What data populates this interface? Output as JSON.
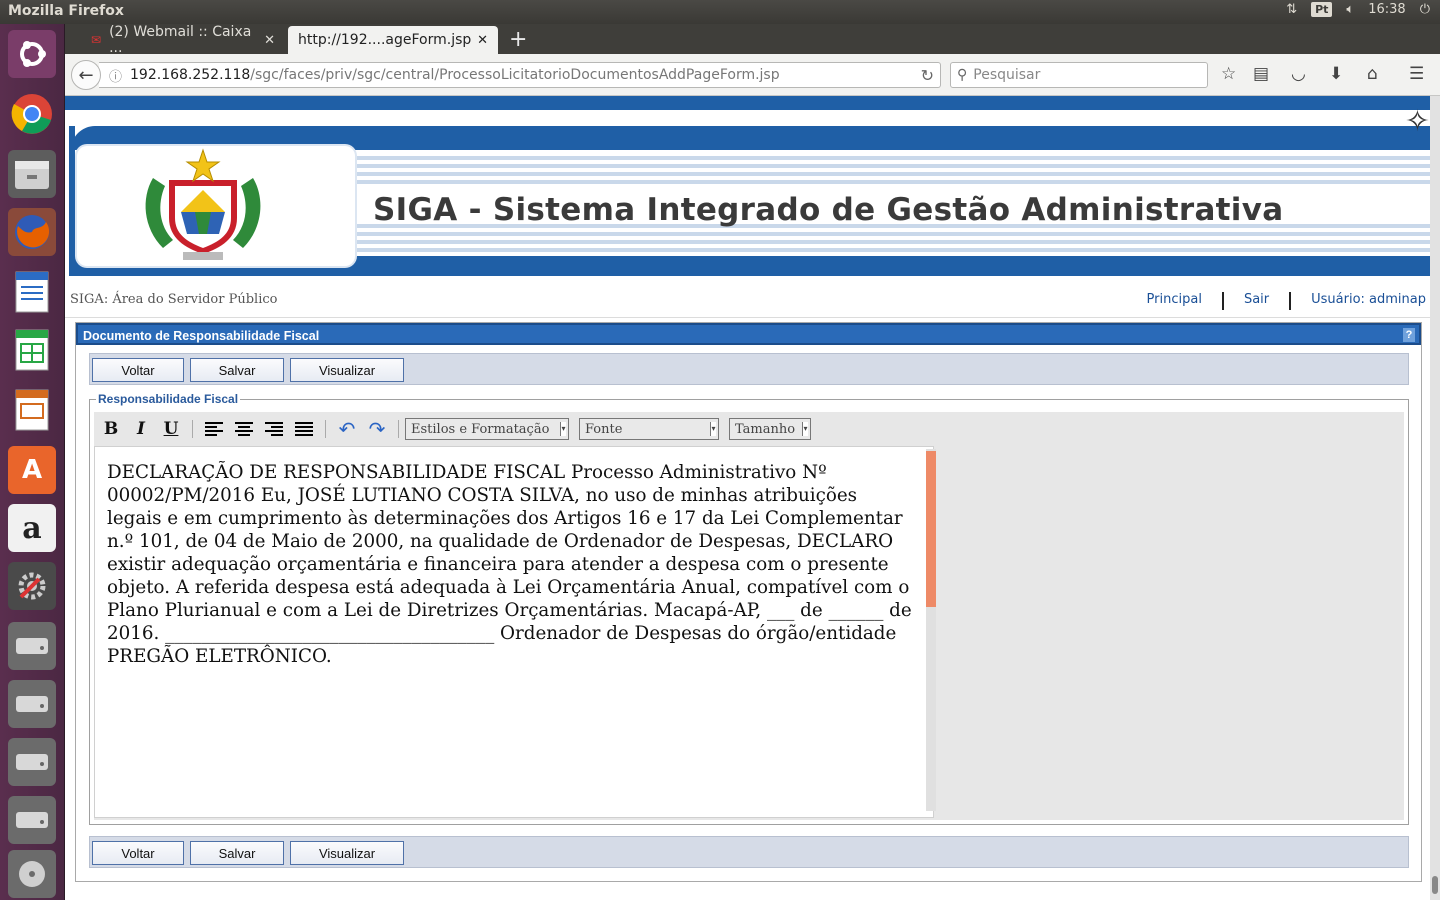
{
  "os": {
    "app_title": "Mozilla Firefox",
    "keyboard_layout": "Pt",
    "clock": "16:38"
  },
  "browser": {
    "tabs": [
      {
        "label": "(2) Webmail :: Caixa ...",
        "active": false
      },
      {
        "label": "http://192....ageForm.jsp",
        "active": true
      }
    ],
    "url_host": "192.168.252.118",
    "url_path": "/sgc/faces/priv/sgc/central/ProcessoLicitatorioDocumentosAddPageForm.jsp",
    "search_placeholder": "Pesquisar"
  },
  "site": {
    "banner_title": "SIGA - Sistema Integrado de Gestão Administrativa",
    "area_label": "SIGA: Área do Servidor Público",
    "nav": {
      "home": "Principal",
      "logout": "Sair",
      "user": "Usuário: adminap"
    }
  },
  "panel": {
    "title": "Documento de Responsabilidade Fiscal",
    "help": "?",
    "buttons": {
      "back": "Voltar",
      "save": "Salvar",
      "preview": "Visualizar"
    },
    "fieldset_legend": "Responsabilidade Fiscal",
    "toolbar": {
      "bold": "B",
      "italic": "I",
      "underline": "U",
      "styles_select": "Estilos e Formatação",
      "font_select": "Fonte",
      "size_select": "Tamanho"
    },
    "document_text": "DECLARAÇÃO DE RESPONSABILIDADE FISCAL Processo Administrativo Nº 00002/PM/2016 Eu, JOSÉ LUTIANO COSTA SILVA, no uso de minhas atribuições legais e em cumprimento às determinações dos Artigos 16 e 17 da Lei Complementar n.º 101, de 04 de Maio de 2000, na qualidade de Ordenador de Despesas, DECLARO existir adequação orçamentária e financeira para atender a despesa com o presente objeto. A referida despesa está adequada à Lei Orçamentária Anual, compatível com o Plano Plurianual e com a Lei de Diretrizes Orçamentárias. Macapá-AP, ___ de ______ de 2016. ____________________________________ Ordenador de Despesas do órgão/entidade PREGÃO ELETRÔNICO."
  }
}
